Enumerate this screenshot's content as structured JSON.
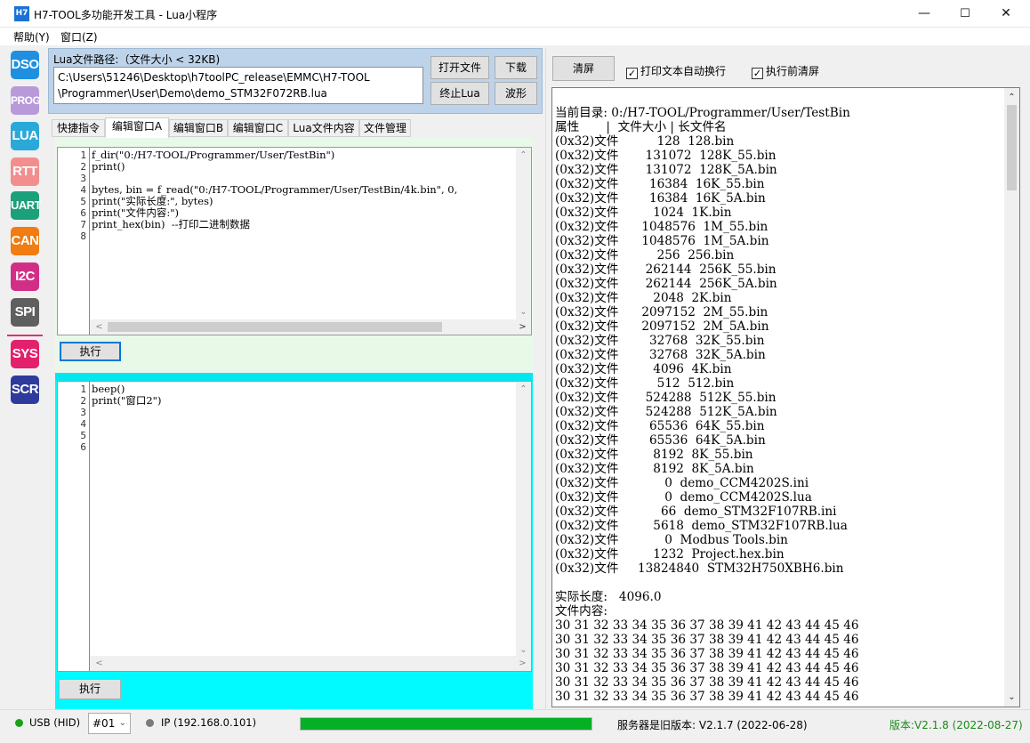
{
  "window": {
    "title": "H7-TOOL多功能开发工具 - Lua小程序",
    "icon_text": "H7",
    "minimize": "—",
    "maximize": "☐",
    "close": "✕"
  },
  "menu": {
    "items": [
      "帮助(Y)",
      "窗口(Z)"
    ]
  },
  "sidebar": {
    "buttons": [
      {
        "label": "DSO",
        "color": "#1f8fe0"
      },
      {
        "label": "PROG",
        "color": "#b89adb"
      },
      {
        "label": "LUA",
        "color": "#2aa9d9"
      },
      {
        "label": "RTT",
        "color": "#f28e8e"
      },
      {
        "label": "UART",
        "color": "#1ba07a"
      },
      {
        "label": "CAN",
        "color": "#f07c12"
      },
      {
        "label": "I2C",
        "color": "#d12f86"
      },
      {
        "label": "SPI",
        "color": "#5f5f5f"
      },
      {
        "label": "SYS",
        "color": "#e3206c"
      },
      {
        "label": "SCR",
        "color": "#2f3b9c"
      }
    ]
  },
  "lua_file": {
    "label": "Lua文件路径:（文件大小 < 32KB)",
    "path_line1": "C:\\Users\\51246\\Desktop\\h7toolPC_release\\EMMC\\H7-TOOL",
    "path_line2": "\\Programmer\\User\\Demo\\demo_STM32F072RB.lua",
    "open_label": "打开文件",
    "download_label": "下载",
    "stop_label": "终止Lua",
    "wave_label": "波形"
  },
  "tabs": [
    "快捷指令",
    "编辑窗口A",
    "编辑窗口B",
    "编辑窗口C",
    "Lua文件内容",
    "文件管理"
  ],
  "editor_a": {
    "line_numbers": "1\n2\n3\n4\n5\n6\n7\n8",
    "code": "f_dir(\"0:/H7-TOOL/Programmer/User/TestBin\")\nprint()\n\nbytes, bin = f_read(\"0:/H7-TOOL/Programmer/User/TestBin/4k.bin\", 0,\nprint(\"实际长度:\", bytes)\nprint(\"文件内容:\")\nprint_hex(bin)  --打印二进制数据",
    "run_label": "执行"
  },
  "editor_b": {
    "line_numbers": "1\n2\n3\n4\n5\n6",
    "code": "beep()\nprint(\"窗口2\")",
    "run_label": "执行"
  },
  "output": {
    "clear_label": "清屏",
    "autowrap_label": "打印文本自动换行",
    "autowrap_checked": "✓",
    "clearbefore_label": "执行前清屏",
    "clearbefore_checked": "✓",
    "text": "当前目录: 0:/H7-TOOL/Programmer/User/TestBin\n属性       |  文件大小 | 长文件名\n(0x32)文件          128  128.bin\n(0x32)文件       131072  128K_55.bin\n(0x32)文件       131072  128K_5A.bin\n(0x32)文件        16384  16K_55.bin\n(0x32)文件        16384  16K_5A.bin\n(0x32)文件         1024  1K.bin\n(0x32)文件      1048576  1M_55.bin\n(0x32)文件      1048576  1M_5A.bin\n(0x32)文件          256  256.bin\n(0x32)文件       262144  256K_55.bin\n(0x32)文件       262144  256K_5A.bin\n(0x32)文件         2048  2K.bin\n(0x32)文件      2097152  2M_55.bin\n(0x32)文件      2097152  2M_5A.bin\n(0x32)文件        32768  32K_55.bin\n(0x32)文件        32768  32K_5A.bin\n(0x32)文件         4096  4K.bin\n(0x32)文件          512  512.bin\n(0x32)文件       524288  512K_55.bin\n(0x32)文件       524288  512K_5A.bin\n(0x32)文件        65536  64K_55.bin\n(0x32)文件        65536  64K_5A.bin\n(0x32)文件         8192  8K_55.bin\n(0x32)文件         8192  8K_5A.bin\n(0x32)文件            0  demo_CCM4202S.ini\n(0x32)文件            0  demo_CCM4202S.lua\n(0x32)文件           66  demo_STM32F107RB.ini\n(0x32)文件         5618  demo_STM32F107RB.lua\n(0x32)文件            0  Modbus Tools.bin\n(0x32)文件         1232  Project.hex.bin\n(0x32)文件     13824840  STM32H750XBH6.bin\n\n实际长度:   4096.0\n文件内容:\n30 31 32 33 34 35 36 37 38 39 41 42 43 44 45 46\n30 31 32 33 34 35 36 37 38 39 41 42 43 44 45 46\n30 31 32 33 34 35 36 37 38 39 41 42 43 44 45 46\n30 31 32 33 34 35 36 37 38 39 41 42 43 44 45 46\n30 31 32 33 34 35 36 37 38 39 41 42 43 44 45 46\n30 31 32 33 34 35 36 37 38 39 41 42 43 44 45 46"
  },
  "status": {
    "usb_label": "USB (HID)",
    "usb_color": "#1aa01a",
    "device": "#01",
    "ip_label": "IP (192.168.0.101)",
    "ip_color": "#7a7a7a",
    "progress_fraction": 1.0,
    "progress_color": "#06b025",
    "server_version": "服务器是旧版本: V2.1.7 (2022-06-28)",
    "local_version": "版本:V2.1.8 (2022-08-27)",
    "local_version_color": "#1a8a1a"
  }
}
